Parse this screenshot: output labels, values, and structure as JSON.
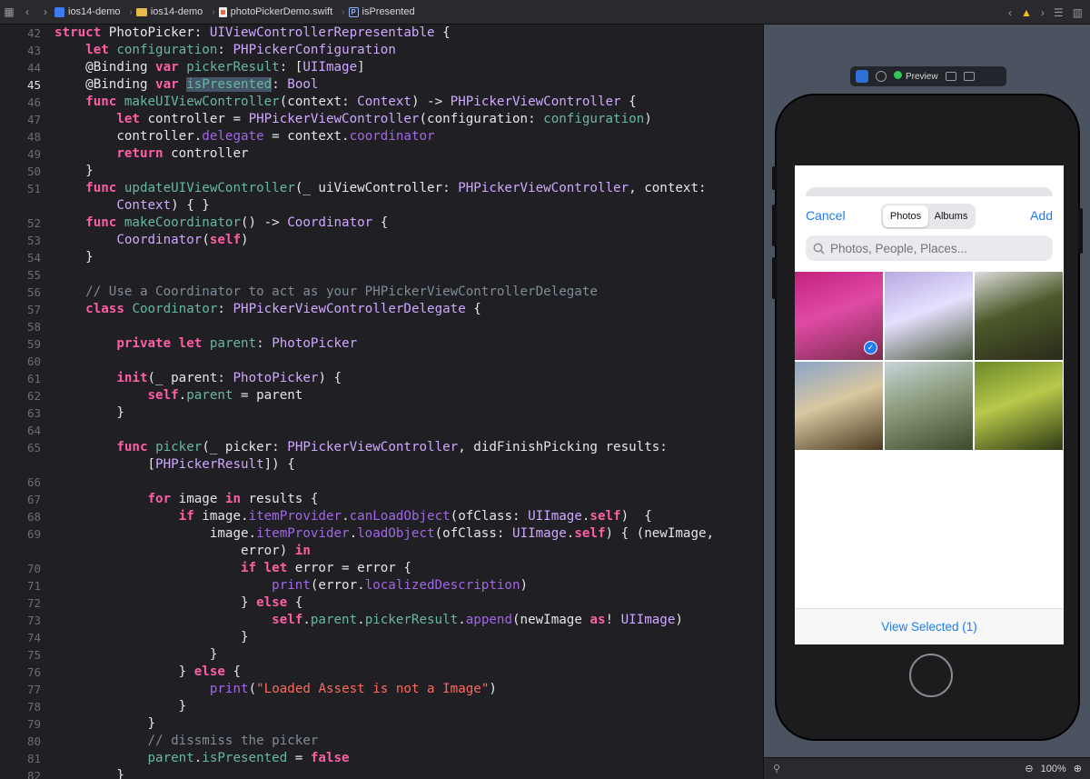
{
  "breadcrumbs": [
    "ios14-demo",
    "ios14-demo",
    "photoPickerDemo.swift",
    "isPresented"
  ],
  "code_lines": [
    {
      "n": "42",
      "h": "<span class='kw'>struct</span> PhotoPicker: <span class='ty'>UIViewControllerRepresentable</span> {"
    },
    {
      "n": "43",
      "h": "    <span class='kw'>let</span> <span class='pc'>configuration</span>: <span class='ty'>PHPickerConfiguration</span>"
    },
    {
      "n": "44",
      "h": "    @Binding <span class='kw'>var</span> <span class='pc'>pickerResult</span>: [<span class='ty'>UIImage</span>]"
    },
    {
      "n": "45",
      "h": "    @Binding <span class='kw'>var</span> <span class='hl'>isPresented</span>: <span class='ty'>Bool</span>",
      "cur": true
    },
    {
      "n": "46",
      "h": "    <span class='kw'>func</span> <span class='fn'>makeUIViewController</span>(context: <span class='ty'>Context</span>) -> <span class='ty'>PHPickerViewController</span> {"
    },
    {
      "n": "47",
      "h": "        <span class='kw'>let</span> controller = <span class='ty'>PHPickerViewController</span>(configuration: <span class='pc'>configuration</span>)"
    },
    {
      "n": "48",
      "h": "        controller.<span class='pr'>delegate</span> = context.<span class='pr'>coordinator</span>"
    },
    {
      "n": "49",
      "h": "        <span class='kw'>return</span> controller"
    },
    {
      "n": "50",
      "h": "    }"
    },
    {
      "n": "51",
      "h": "    <span class='kw'>func</span> <span class='fn'>updateUIViewController</span>(_ uiViewController: <span class='ty'>PHPickerViewController</span>, context:"
    },
    {
      "n": "",
      "h": "        <span class='ty'>Context</span>) { }"
    },
    {
      "n": "52",
      "h": "    <span class='kw'>func</span> <span class='fn'>makeCoordinator</span>() -> <span class='ty'>Coordinator</span> {"
    },
    {
      "n": "53",
      "h": "        <span class='ty'>Coordinator</span>(<span class='kw'>self</span>)"
    },
    {
      "n": "54",
      "h": "    }"
    },
    {
      "n": "55",
      "h": ""
    },
    {
      "n": "56",
      "h": "    <span class='cm'>// Use a Coordinator to act as your PHPickerViewControllerDelegate</span>"
    },
    {
      "n": "57",
      "h": "    <span class='kw'>class</span> <span class='fn'>Coordinator</span>: <span class='ty'>PHPickerViewControllerDelegate</span> {"
    },
    {
      "n": "58",
      "h": ""
    },
    {
      "n": "59",
      "h": "        <span class='kw'>private let</span> <span class='pc'>parent</span>: <span class='ty'>PhotoPicker</span>"
    },
    {
      "n": "60",
      "h": ""
    },
    {
      "n": "61",
      "h": "        <span class='kw'>init</span>(_ parent: <span class='ty'>PhotoPicker</span>) {"
    },
    {
      "n": "62",
      "h": "            <span class='kw'>self</span>.<span class='pc'>parent</span> = parent"
    },
    {
      "n": "63",
      "h": "        }"
    },
    {
      "n": "64",
      "h": ""
    },
    {
      "n": "65",
      "h": "        <span class='kw'>func</span> <span class='fn'>picker</span>(_ picker: <span class='ty'>PHPickerViewController</span>, didFinishPicking results:"
    },
    {
      "n": "",
      "h": "            [<span class='ty'>PHPickerResult</span>]) {"
    },
    {
      "n": "66",
      "h": ""
    },
    {
      "n": "67",
      "h": "            <span class='kw'>for</span> image <span class='kw'>in</span> results {"
    },
    {
      "n": "68",
      "h": "                <span class='kw'>if</span> image.<span class='pr'>itemProvider</span>.<span class='pr'>canLoadObject</span>(ofClass: <span class='ty'>UIImage</span>.<span class='kw'>self</span>)  {"
    },
    {
      "n": "69",
      "h": "                    image.<span class='pr'>itemProvider</span>.<span class='pr'>loadObject</span>(ofClass: <span class='ty'>UIImage</span>.<span class='kw'>self</span>) { (newImage,"
    },
    {
      "n": "",
      "h": "                        error) <span class='kw'>in</span>"
    },
    {
      "n": "70",
      "h": "                        <span class='kw'>if let</span> error = error {"
    },
    {
      "n": "71",
      "h": "                            <span class='pr'>print</span>(error.<span class='pr'>localizedDescription</span>)"
    },
    {
      "n": "72",
      "h": "                        } <span class='kw'>else</span> {"
    },
    {
      "n": "73",
      "h": "                            <span class='kw'>self</span>.<span class='pc'>parent</span>.<span class='pc'>pickerResult</span>.<span class='pr'>append</span>(newImage <span class='kw'>as</span>! <span class='ty'>UIImage</span>)"
    },
    {
      "n": "74",
      "h": "                        }"
    },
    {
      "n": "75",
      "h": "                    }"
    },
    {
      "n": "76",
      "h": "                } <span class='kw'>else</span> {"
    },
    {
      "n": "77",
      "h": "                    <span class='pr'>print</span>(<span class='st'>\"Loaded Assest is not a Image\"</span>)"
    },
    {
      "n": "78",
      "h": "                }"
    },
    {
      "n": "79",
      "h": "            }"
    },
    {
      "n": "80",
      "h": "            <span class='cm'>// dissmiss the picker</span>"
    },
    {
      "n": "81",
      "h": "            <span class='pc'>parent</span>.<span class='pc'>isPresented</span> = <span class='kw'>false</span>"
    },
    {
      "n": "82",
      "h": "        }"
    }
  ],
  "preview": {
    "toolbar_label": "Preview",
    "picker": {
      "cancel_label": "Cancel",
      "add_label": "Add",
      "segments": [
        "Photos",
        "Albums"
      ],
      "selected_segment": "Photos",
      "search_placeholder": "Photos, People, Places...",
      "photos": [
        {
          "name": "pink-flowers",
          "selected": true,
          "colors": [
            "#c2227e",
            "#e04aa6",
            "#7a2d4d"
          ]
        },
        {
          "name": "waterfall-purple",
          "selected": false,
          "colors": [
            "#b7a9e0",
            "#e6e0ff",
            "#4a5a3a"
          ]
        },
        {
          "name": "rushing-water",
          "selected": false,
          "colors": [
            "#dcdcdc",
            "#4c5a2a",
            "#2a2a1a"
          ]
        },
        {
          "name": "canyon-falls",
          "selected": false,
          "colors": [
            "#8aa4c8",
            "#d9c7a0",
            "#4b3a20"
          ]
        },
        {
          "name": "foggy-field",
          "selected": false,
          "colors": [
            "#c8d4d8",
            "#8a9a7a",
            "#3b4a2a"
          ]
        },
        {
          "name": "green-leaves",
          "selected": false,
          "colors": [
            "#6b8a2a",
            "#b8c84a",
            "#2e3a14"
          ]
        }
      ],
      "check_glyph": "✓",
      "bottom_label": "View Selected (1)"
    },
    "zoom_label": "100%"
  }
}
